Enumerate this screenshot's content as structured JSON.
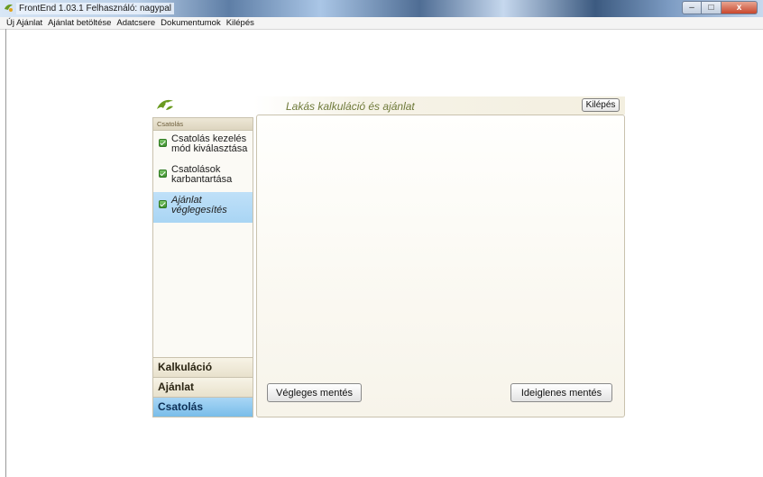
{
  "window": {
    "title": "FrontEnd 1.03.1   Felhasználó: nagypal",
    "controls": {
      "minimize": "–",
      "maximize": "□",
      "close": "x"
    }
  },
  "menu": {
    "items": [
      "Új Ajánlat",
      "Ajánlat betöltése",
      "Adatcsere",
      "Dokumentumok",
      "Kilépés"
    ]
  },
  "panel": {
    "title": "Lakás kalkuláció és ajánlat",
    "exit_label": "Kilépés"
  },
  "sidebar": {
    "header": "Csatolás",
    "steps": [
      {
        "label": "Csatolás kezelés mód kiválasztása",
        "checked": true,
        "active": false
      },
      {
        "label": "Csatolások karbantartása",
        "checked": true,
        "active": false
      },
      {
        "label": "Ajánlat véglegesítés",
        "checked": true,
        "active": true
      }
    ],
    "sections": [
      {
        "label": "Kalkuláció",
        "active": false
      },
      {
        "label": "Ajánlat",
        "active": false
      },
      {
        "label": "Csatolás",
        "active": true
      }
    ]
  },
  "content": {
    "final_save_label": "Végleges mentés",
    "temp_save_label": "Ideiglenes mentés"
  },
  "colors": {
    "accent_active": "#a9d5f4",
    "title_text": "#6f7a3a",
    "logo_green": "#6a9a1f"
  }
}
